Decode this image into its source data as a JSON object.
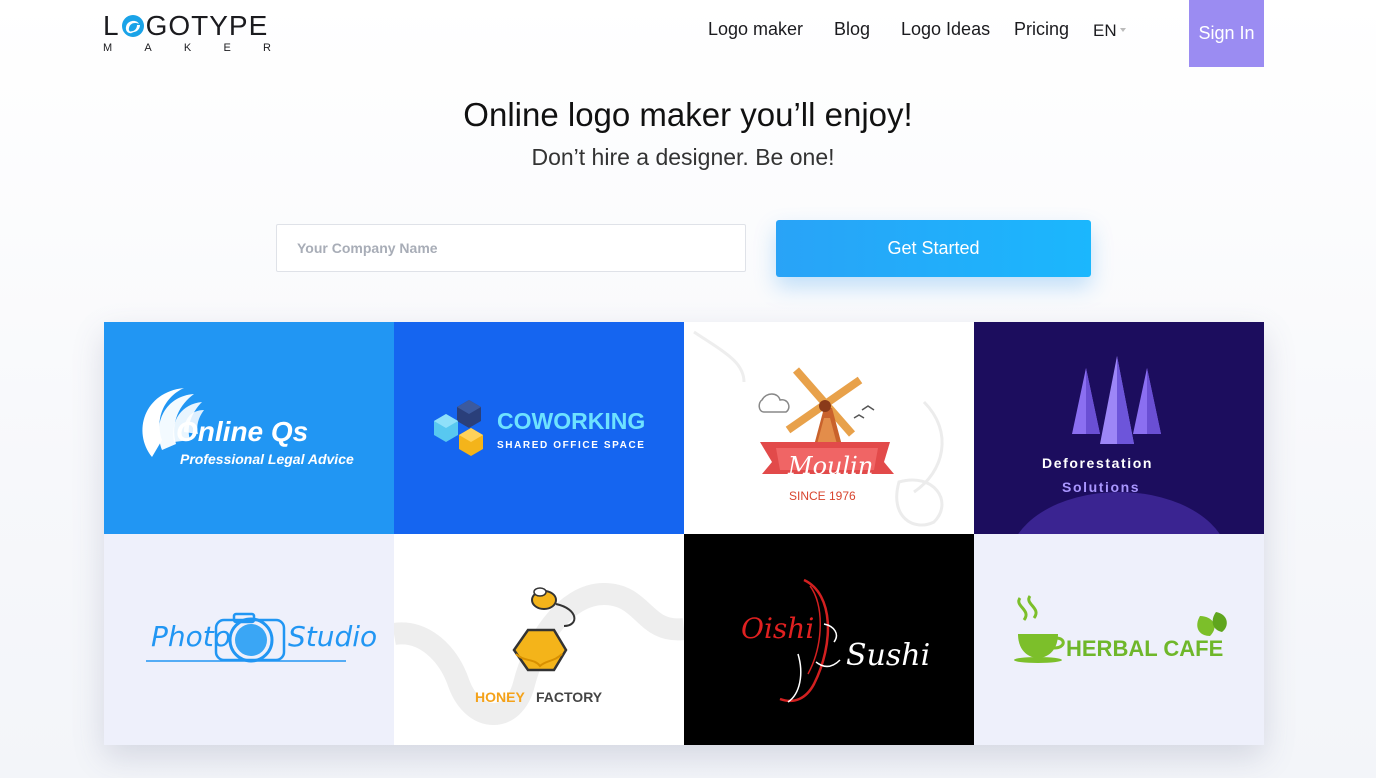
{
  "header": {
    "logo": {
      "top_left": "L",
      "top_right": "GOTYPE",
      "sub_letters": [
        "M",
        "A",
        "K",
        "E",
        "R"
      ]
    },
    "nav": [
      {
        "label": "Logo maker"
      },
      {
        "label": "Blog"
      },
      {
        "label": "Logo Ideas"
      },
      {
        "label": "Pricing"
      }
    ],
    "language": "EN",
    "signin_label": "Sign In"
  },
  "hero": {
    "title": "Online logo maker you’ll enjoy!",
    "subtitle": "Don’t hire a designer. Be one!",
    "input_placeholder": "Your Company Name",
    "input_value": "",
    "cta_label": "Get Started"
  },
  "colors": {
    "accent": "#1bb7fd",
    "signin_bg": "#9b8cf2"
  },
  "gallery": [
    {
      "name": "Online Qs",
      "tagline": "Professional Legal Advice",
      "bg": "#2196f3",
      "icon": "swirl-icon"
    },
    {
      "name": "COWORKING",
      "tagline": "SHARED OFFICE SPACE",
      "bg": "#1565f0",
      "icon": "hexagon-cubes-icon"
    },
    {
      "name": "Moulin",
      "tagline": "SINCE 1976",
      "bg": "#ffffff",
      "icon": "windmill-icon"
    },
    {
      "name": "Deforestation",
      "tagline": "Solutions",
      "bg": "#1c0d5e",
      "icon": "trees-icon"
    },
    {
      "name": "Photo",
      "tagline": "Studio",
      "bg": "#eef0fb",
      "icon": "camera-icon"
    },
    {
      "name": "HONEY",
      "tagline": "FACTORY",
      "bg": "#ffffff",
      "icon": "bee-honeycomb-icon"
    },
    {
      "name": "Oishi",
      "tagline": "Sushi",
      "bg": "#000000",
      "icon": "koi-fish-icon"
    },
    {
      "name": "HERBAL CAFE",
      "tagline": "",
      "bg": "#eef0fb",
      "icon": "tea-cup-icon"
    }
  ]
}
